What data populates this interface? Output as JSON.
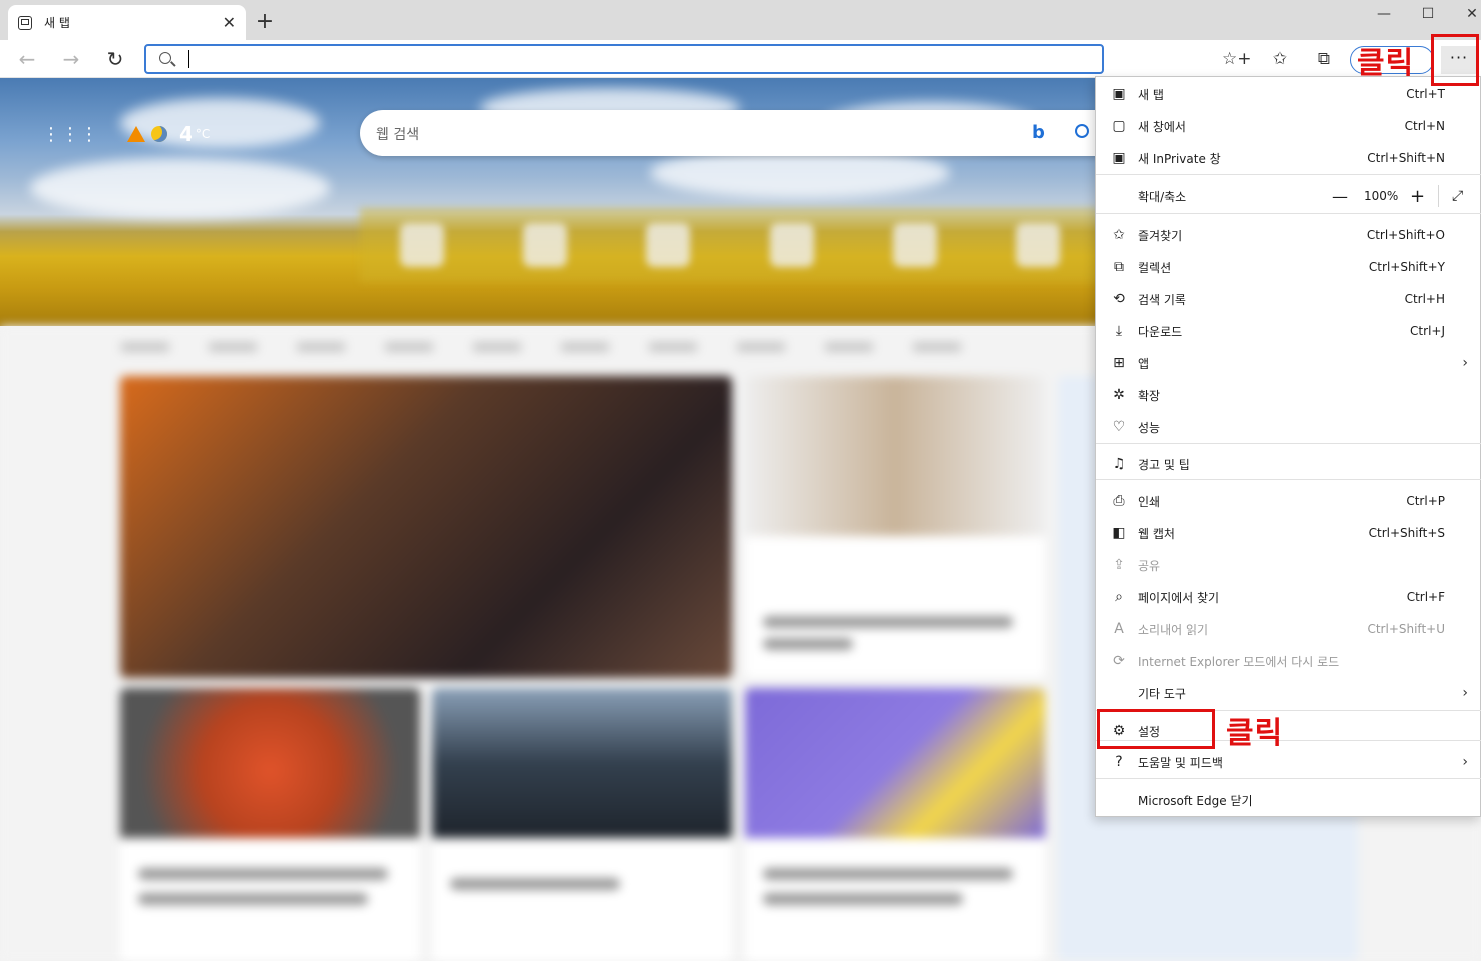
{
  "tab": {
    "title": "새 탭",
    "close": "✕"
  },
  "new_tab_symbol": "+",
  "window_controls": {
    "minimize": "—",
    "maximize": "☐",
    "close": "✕"
  },
  "nav": {
    "back": "←",
    "forward": "→",
    "refresh": "↻"
  },
  "address": {
    "value": "",
    "placeholder": ""
  },
  "toolbar_icons": {
    "add_favorite": "☆+",
    "favorites": "✩",
    "collections": "⧉",
    "more": "···"
  },
  "weather": {
    "apps": "⋮⋮⋮",
    "temperature": "4",
    "unit": "°C"
  },
  "web_search": {
    "placeholder": "웹 검색",
    "bing": "b"
  },
  "menu": {
    "items": [
      {
        "icon": "▣",
        "label": "새 탭",
        "shortcut": "Ctrl+T"
      },
      {
        "icon": "▢",
        "label": "새 창에서",
        "shortcut": "Ctrl+N"
      },
      {
        "icon": "▣",
        "label": "새 InPrivate 창",
        "shortcut": "Ctrl+Shift+N"
      },
      {
        "label": "확대/축소",
        "zoom_value": "100%",
        "zoom_minus": "—",
        "zoom_plus": "+",
        "fullscreen": "⤢"
      },
      {
        "icon": "✩",
        "label": "즐겨찾기",
        "shortcut": "Ctrl+Shift+O"
      },
      {
        "icon": "⧉",
        "label": "컬렉션",
        "shortcut": "Ctrl+Shift+Y"
      },
      {
        "icon": "⟲",
        "label": "검색 기록",
        "shortcut": "Ctrl+H"
      },
      {
        "icon": "⤓",
        "label": "다운로드",
        "shortcut": "Ctrl+J"
      },
      {
        "icon": "⊞",
        "label": "앱",
        "chevron": "›"
      },
      {
        "icon": "✲",
        "label": "확장"
      },
      {
        "icon": "♡",
        "label": "성능"
      },
      {
        "icon": "♫",
        "label": "경고 및 팁"
      },
      {
        "icon": "⎙",
        "label": "인쇄",
        "shortcut": "Ctrl+P"
      },
      {
        "icon": "◧",
        "label": "웹 캡처",
        "shortcut": "Ctrl+Shift+S"
      },
      {
        "icon": "⇪",
        "label": "공유"
      },
      {
        "icon": "⌕",
        "label": "페이지에서 찾기",
        "shortcut": "Ctrl+F"
      },
      {
        "icon": "A",
        "label": "소리내어 읽기",
        "shortcut": "Ctrl+Shift+U"
      },
      {
        "icon": "⟳",
        "label": "Internet Explorer 모드에서 다시 로드"
      },
      {
        "label": "기타 도구",
        "chevron": "›"
      },
      {
        "icon": "⚙",
        "label": "설정"
      },
      {
        "icon": "?",
        "label": "도움말 및 피드백",
        "chevron": "›"
      },
      {
        "label": "Microsoft Edge 닫기"
      }
    ]
  },
  "annotations": {
    "more_click": "클릭",
    "settings_click": "클릭"
  },
  "colors": {
    "accent": "#3a7bd5",
    "annotation": "#e01010"
  }
}
